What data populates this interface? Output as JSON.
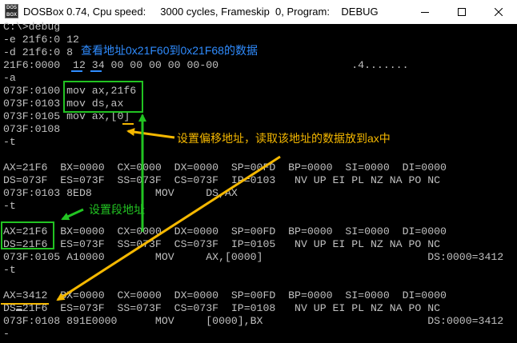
{
  "window": {
    "title": "DOSBox 0.74, Cpu speed:     3000 cycles, Frameskip  0, Program:    DEBUG",
    "icon_text": "DOS BOX"
  },
  "console": {
    "lines": [
      "C:\\>debug",
      "-e 21f6:0 12",
      "-d 21f6:0 8",
      "21F6:0000  12 34 00 00 00 00 00-00                     .4.......",
      "-a",
      "073F:0100 mov ax,21f6",
      "073F:0103 mov ds,ax",
      "073F:0105 mov ax,[0]",
      "073F:0108",
      "-t",
      "",
      "AX=21F6  BX=0000  CX=0000  DX=0000  SP=00FD  BP=0000  SI=0000  DI=0000",
      "DS=073F  ES=073F  SS=073F  CS=073F  IP=0103   NV UP EI PL NZ NA PO NC",
      "073F:0103 8ED8          MOV     DS,AX",
      "-t",
      "",
      "AX=21F6  BX=0000  CX=0000  DX=0000  SP=00FD  BP=0000  SI=0000  DI=0000",
      "DS=21F6  ES=073F  SS=073F  CS=073F  IP=0105   NV UP EI PL NZ NA PO NC",
      "073F:0105 A10000        MOV     AX,[0000]                          DS:0000=3412",
      "-t",
      "",
      "AX=3412  BX=0000  CX=0000  DX=0000  SP=00FD  BP=0000  SI=0000  DI=0000",
      "DS=21F6  ES=073F  SS=073F  CS=073F  IP=0108   NV UP EI PL NZ NA PO NC",
      "073F:0108 891E0000      MOV     [0000],BX                          DS:0000=3412",
      "-"
    ]
  },
  "annotations": {
    "view_data": "查看地址0x21F60到0x21F68的数据",
    "set_offset": "设置偏移地址，读取该地址的数据放到ax中",
    "set_segment": "设置段地址"
  },
  "colors": {
    "console_text": "#c0c0c0",
    "annotation_blue": "#2f8cff",
    "annotation_yellow": "#f5b800",
    "annotation_green": "#22c322",
    "arrow_yellow": "#f5b800",
    "arrow_green": "#22c322"
  }
}
